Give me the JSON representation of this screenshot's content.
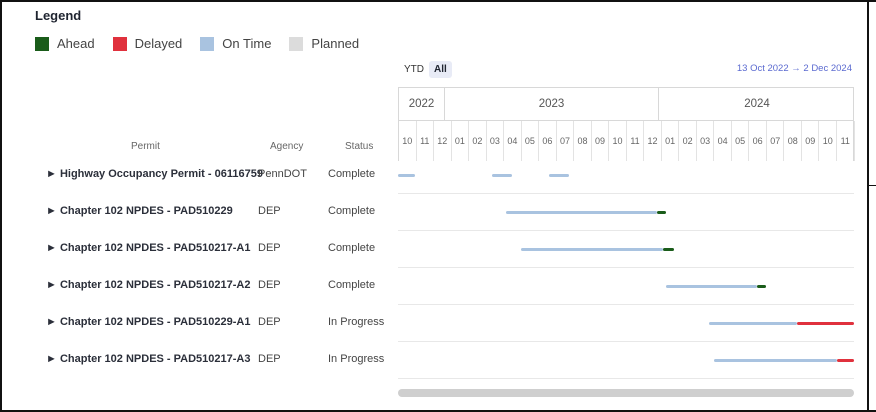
{
  "legend": {
    "title": "Legend",
    "items": [
      {
        "label": "Ahead",
        "color": "#1a5c1a"
      },
      {
        "label": "Delayed",
        "color": "#e0313d"
      },
      {
        "label": "On Time",
        "color": "#a9c3e0"
      },
      {
        "label": "Planned",
        "color": "#dcdcdc"
      }
    ]
  },
  "range_buttons": [
    {
      "label": "YTD",
      "active": false
    },
    {
      "label": "All",
      "active": true
    }
  ],
  "date_range": "13 Oct 2022 → 2 Dec 2024",
  "years": [
    "2022",
    "2023",
    "2024"
  ],
  "months": [
    "10",
    "11",
    "12",
    "01",
    "02",
    "03",
    "04",
    "05",
    "06",
    "07",
    "08",
    "09",
    "10",
    "11",
    "12",
    "01",
    "02",
    "03",
    "04",
    "05",
    "06",
    "07",
    "08",
    "09",
    "10",
    "11"
  ],
  "columns": {
    "permit": "Permit",
    "agency": "Agency",
    "status": "Status"
  },
  "rows": [
    {
      "permit": "► Highway Occupancy Permit - 06116759",
      "agency": "PennDOT",
      "status": "Complete",
      "segments": [
        {
          "start": 0.0,
          "end": 0.6,
          "type": "ontime"
        },
        {
          "start": 3.3,
          "end": 4.0,
          "type": "ontime"
        },
        {
          "start": 5.3,
          "end": 6.0,
          "type": "ontime"
        }
      ]
    },
    {
      "permit": "► Chapter 102 NPDES - PAD510229",
      "agency": "DEP",
      "status": "Complete",
      "segments": [
        {
          "start": 3.8,
          "end": 9.1,
          "type": "ontime"
        },
        {
          "start": 9.1,
          "end": 9.4,
          "type": "ahead"
        }
      ]
    },
    {
      "permit": "► Chapter 102 NPDES - PAD510217-A1",
      "agency": "DEP",
      "status": "Complete",
      "segments": [
        {
          "start": 4.3,
          "end": 9.3,
          "type": "ontime"
        },
        {
          "start": 9.3,
          "end": 9.7,
          "type": "ahead"
        }
      ]
    },
    {
      "permit": "► Chapter 102 NPDES - PAD510217-A2",
      "agency": "DEP",
      "status": "Complete",
      "segments": [
        {
          "start": 9.4,
          "end": 12.6,
          "type": "ontime"
        },
        {
          "start": 12.6,
          "end": 12.9,
          "type": "ahead"
        }
      ]
    },
    {
      "permit": "► Chapter 102 NPDES - PAD510229-A1",
      "agency": "DEP",
      "status": "In Progress",
      "segments": [
        {
          "start": 10.9,
          "end": 14.0,
          "type": "ontime"
        },
        {
          "start": 14.0,
          "end": 16.0,
          "type": "delayed"
        }
      ]
    },
    {
      "permit": "► Chapter 102 NPDES - PAD510217-A3",
      "agency": "DEP",
      "status": "In Progress",
      "segments": [
        {
          "start": 11.1,
          "end": 15.4,
          "type": "ontime"
        },
        {
          "start": 15.4,
          "end": 16.0,
          "type": "delayed"
        }
      ]
    }
  ]
}
